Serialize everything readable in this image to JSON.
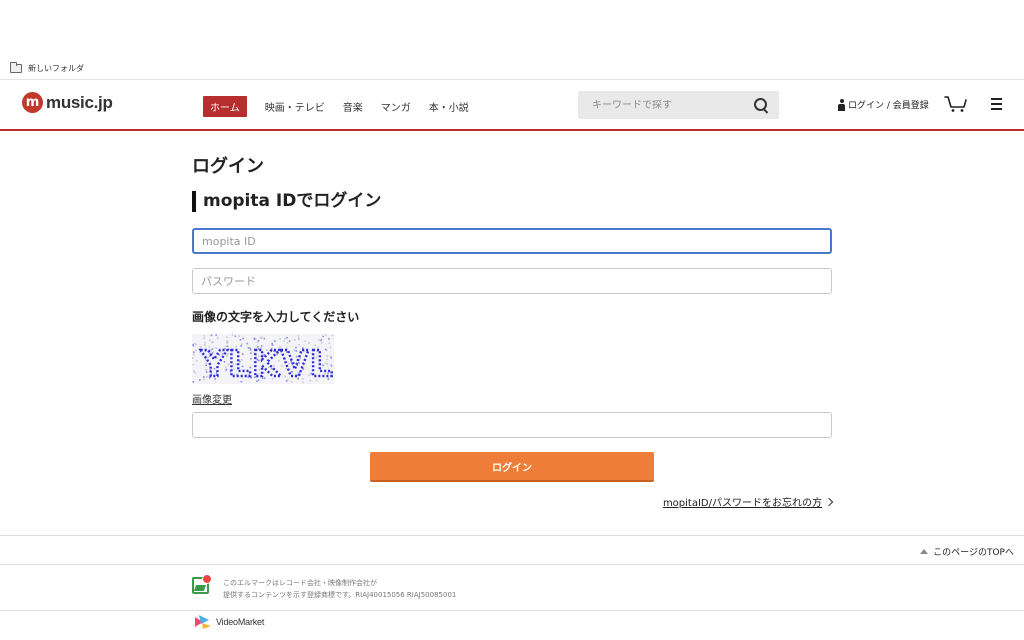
{
  "bookmarks": {
    "folder_label": "新しいフォルダ",
    "folder_icon": "folder-icon"
  },
  "header": {
    "logo_mark": "m",
    "logo_text": "music.jp",
    "brand_color": "#b82d2d",
    "nav": [
      {
        "label": "ホーム",
        "active": true
      },
      {
        "label": "映画・テレビ",
        "active": false
      },
      {
        "label": "音楽",
        "active": false
      },
      {
        "label": "マンガ",
        "active": false
      },
      {
        "label": "本・小説",
        "active": false
      }
    ],
    "search": {
      "placeholder": "キーワードで探す",
      "icon": "search-icon"
    },
    "login_label": "ログイン / 会員登録",
    "cart_icon": "cart-icon",
    "menu_icon": "hamburger-menu-icon"
  },
  "main": {
    "page_title": "ログイン",
    "section_title": "mopita IDでログイン",
    "id_field": {
      "placeholder": "mopita ID",
      "value": ""
    },
    "password_field": {
      "placeholder": "パスワード",
      "value": ""
    },
    "captcha_label": "画像の文字を入力してください",
    "captcha_text": "YLKVL",
    "captcha_change": "画像変更",
    "captcha_answer": {
      "placeholder": "",
      "value": ""
    },
    "login_button": "ログイン",
    "login_button_color": "#ee7d3a",
    "forgot_link": "mopitaID/パスワードをお忘れの方"
  },
  "footer": {
    "page_top": "このページのTOPへ",
    "lmark_line1": "このエルマークはレコード会社・映像制作会社が",
    "lmark_line2": "提供するコンテンツを示す登録商標です。RIAJ40015056 RIAJ50085001",
    "vm_text": "VideoMarket"
  }
}
